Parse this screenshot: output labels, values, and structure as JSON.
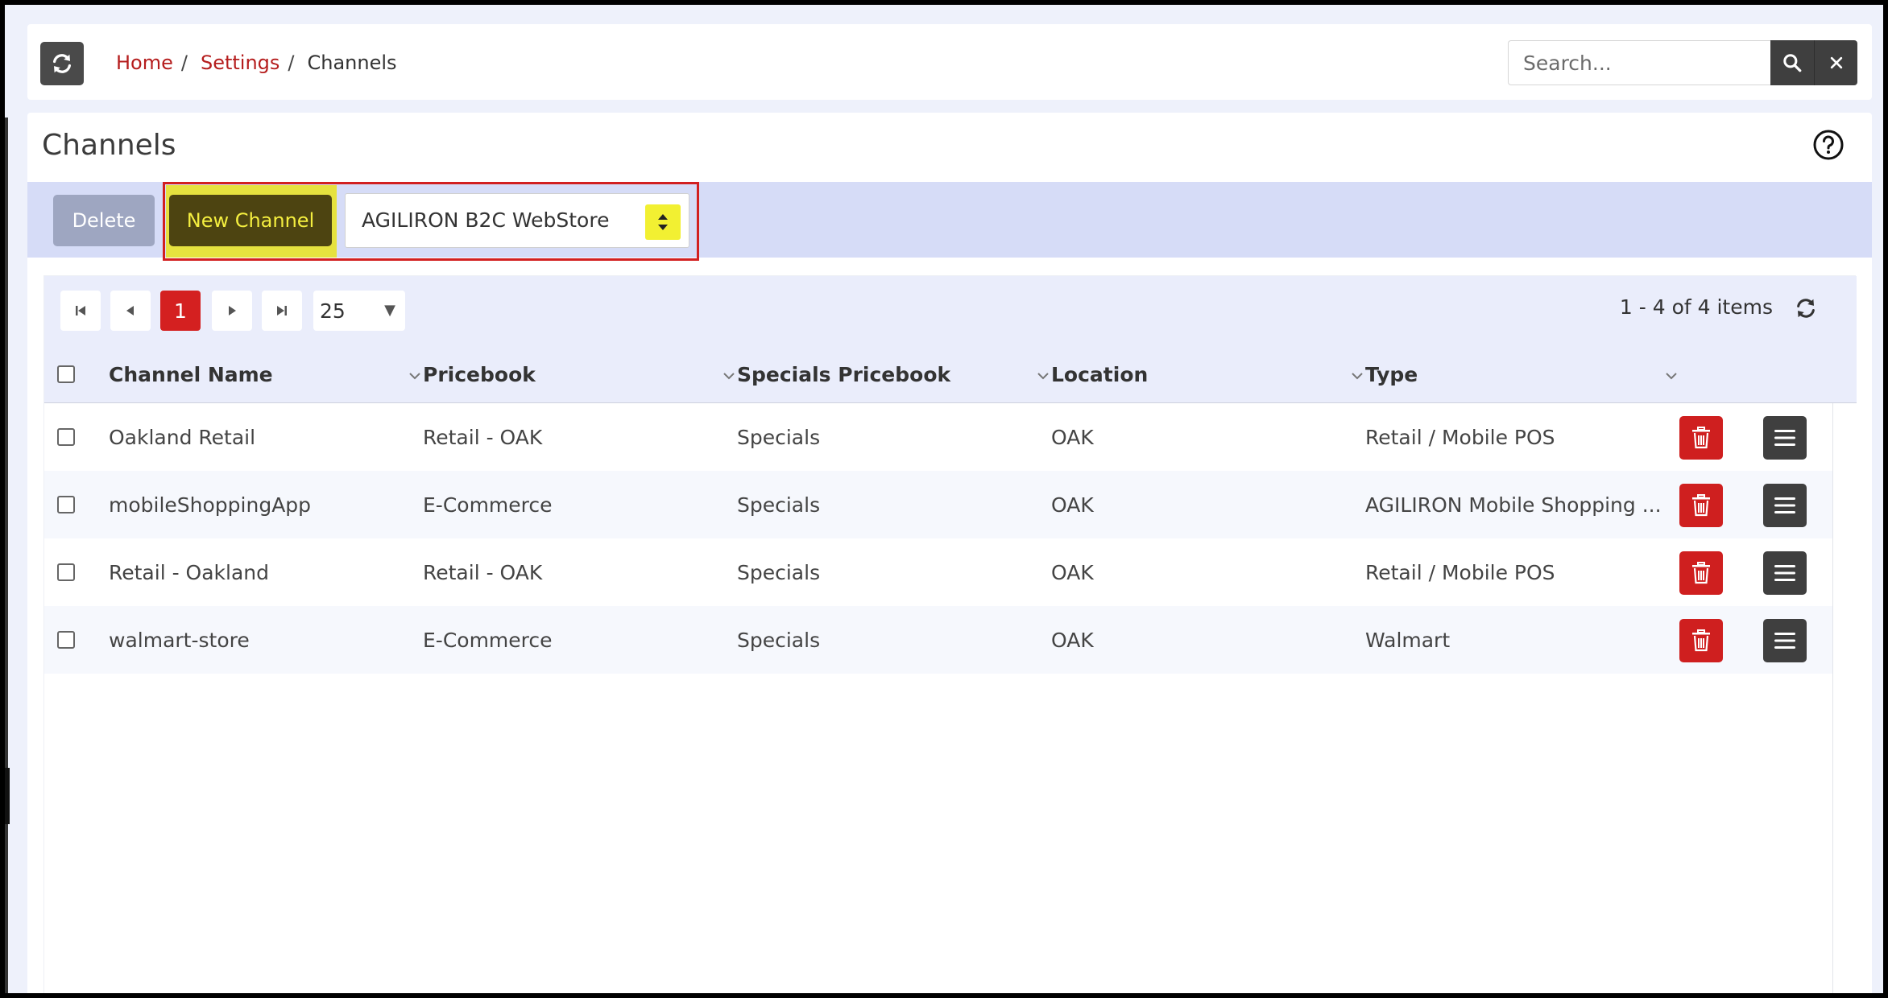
{
  "breadcrumb": {
    "home": "Home",
    "settings": "Settings",
    "current": "Channels",
    "sep": "/"
  },
  "search": {
    "placeholder": "Search...",
    "value": ""
  },
  "page": {
    "title": "Channels"
  },
  "toolbar": {
    "delete_label": "Delete",
    "new_channel_label": "New Channel",
    "channel_type_selected": "AGILIRON B2C WebStore"
  },
  "pager": {
    "current_page": "1",
    "page_size": "25",
    "info": "1 - 4 of 4 items"
  },
  "columns": [
    "Channel Name",
    "Pricebook",
    "Specials Pricebook",
    "Location",
    "Type"
  ],
  "rows": [
    {
      "name": "Oakland Retail",
      "pricebook": "Retail - OAK",
      "specials": "Specials",
      "location": "OAK",
      "type": "Retail / Mobile POS"
    },
    {
      "name": "mobileShoppingApp",
      "pricebook": "E-Commerce",
      "specials": "Specials",
      "location": "OAK",
      "type": "AGILIRON Mobile Shopping ..."
    },
    {
      "name": "Retail - Oakland",
      "pricebook": "Retail - OAK",
      "specials": "Specials",
      "location": "OAK",
      "type": "Retail / Mobile POS"
    },
    {
      "name": "walmart-store",
      "pricebook": "E-Commerce",
      "specials": "Specials",
      "location": "OAK",
      "type": "Walmart"
    }
  ],
  "colors": {
    "accent_red": "#d42020",
    "link_red": "#b51d1d",
    "highlight_yellow": "#e6e23f",
    "toolbar_bg": "#d6dcf7",
    "dark_button": "#3f3f3f"
  },
  "icons": {
    "refresh": "refresh-icon",
    "search": "search-icon",
    "clear": "close-icon",
    "help": "help-icon",
    "first": "first-page-icon",
    "prev": "prev-page-icon",
    "next": "next-page-icon",
    "last": "last-page-icon",
    "delete_row": "trash-icon",
    "row_menu": "hamburger-icon"
  }
}
